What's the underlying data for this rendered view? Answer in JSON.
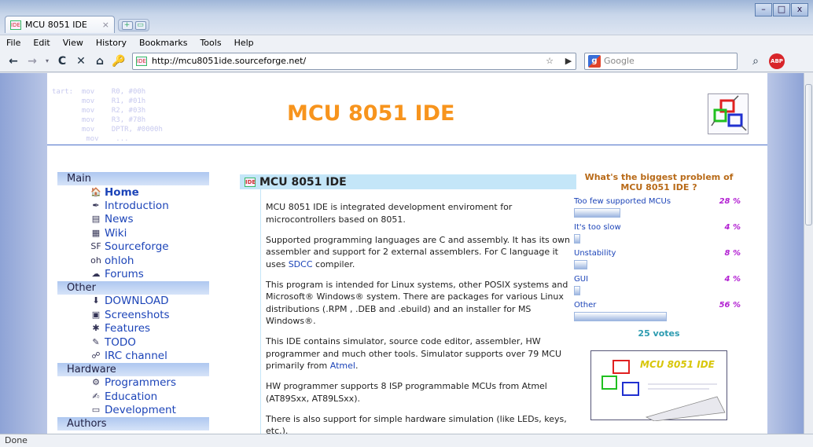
{
  "window": {
    "controls": [
      "–",
      "□",
      "x"
    ]
  },
  "tab": {
    "title": "MCU 8051 IDE",
    "close": "×"
  },
  "menu": [
    "File",
    "Edit",
    "View",
    "History",
    "Bookmarks",
    "Tools",
    "Help"
  ],
  "nav": {
    "back": "←",
    "forward": "→",
    "dropdown": "▾",
    "reload": "C",
    "stop": "✕",
    "home": "⌂",
    "url": "http://mcu8051ide.sourceforge.net/",
    "search_placeholder": "Google",
    "search_engine_letter": "g",
    "adblock_label": "ABP",
    "bookmark_star": "☆",
    "go_arrow": "▶",
    "search_button": "⌕"
  },
  "page": {
    "code_background": "tart:  mov    R0, #00h\n       mov    R1, #01h\n       mov    R2, #03h\n       mov    R3, #78h\n       mov    DPTR, #0000h\n        mov    ...",
    "site_title": "MCU 8051 IDE",
    "sidebar": {
      "sections": [
        {
          "title": "Main",
          "items": [
            {
              "label": "Home",
              "icon": "home-icon",
              "glyph": "🏠",
              "active": true
            },
            {
              "label": "Introduction",
              "icon": "pen-icon",
              "glyph": "✒",
              "active": false
            },
            {
              "label": "News",
              "icon": "news-icon",
              "glyph": "▤",
              "active": false
            },
            {
              "label": "Wiki",
              "icon": "wiki-icon",
              "glyph": "▦",
              "active": false
            },
            {
              "label": "Sourceforge",
              "icon": "sourceforge-icon",
              "glyph": "SF",
              "active": false
            },
            {
              "label": "ohloh",
              "icon": "ohloh-icon",
              "glyph": "oh",
              "active": false
            },
            {
              "label": "Forums",
              "icon": "forums-icon",
              "glyph": "☁",
              "active": false
            }
          ]
        },
        {
          "title": "Other",
          "items": [
            {
              "label": "DOWNLOAD",
              "icon": "download-icon",
              "glyph": "⬇",
              "active": false
            },
            {
              "label": "Screenshots",
              "icon": "screenshot-icon",
              "glyph": "▣",
              "active": false
            },
            {
              "label": "Features",
              "icon": "gear-icon",
              "glyph": "✱",
              "active": false
            },
            {
              "label": "TODO",
              "icon": "todo-icon",
              "glyph": "✎",
              "active": false
            },
            {
              "label": "IRC channel",
              "icon": "irc-icon",
              "glyph": "☍",
              "active": false
            }
          ]
        },
        {
          "title": "Hardware",
          "items": [
            {
              "label": "Programmers",
              "icon": "chip-icon",
              "glyph": "⚙",
              "active": false
            },
            {
              "label": "Education",
              "icon": "education-icon",
              "glyph": "✍",
              "active": false
            },
            {
              "label": "Development",
              "icon": "development-icon",
              "glyph": "▭",
              "active": false
            }
          ]
        },
        {
          "title": "Authors",
          "items": []
        }
      ]
    },
    "main": {
      "heading": "MCU 8051 IDE",
      "paragraphs": [
        {
          "text": "MCU 8051 IDE is integrated development enviroment for microcontrollers based on 8051."
        },
        {
          "text": "Supported programming languages are C and assembly. It has its own assembler and support for 2 external assemblers. For C language it uses ",
          "link": "SDCC",
          "after": " compiler."
        },
        {
          "text": "This program is intended for Linux systems, other POSIX systems and Microsoft® Windows® system. There are packages for various Linux distributions (.RPM , .DEB and .ebuild) and an installer for MS Windows®."
        },
        {
          "text": "This IDE contains simulator, source code editor, assembler, HW programmer and much other tools. Simulator supports over 79 MCU primarily from ",
          "link": "Atmel",
          "after": "."
        },
        {
          "text": "HW programmer supports 8 ISP programmable MCUs from Atmel (AT89Sxx, AT89LSxx)."
        },
        {
          "text": "There is also support for simple hardware simulation (like LEDs, keys, etc.)."
        }
      ]
    },
    "poll": {
      "question": "What's the biggest problem of MCU 8051 IDE ?",
      "options": [
        {
          "label": "Too few supported MCUs",
          "percent": "28 %",
          "value": 0.28
        },
        {
          "label": "It's too slow",
          "percent": "4 %",
          "value": 0.04
        },
        {
          "label": "Unstability",
          "percent": "8 %",
          "value": 0.08
        },
        {
          "label": "GUI",
          "percent": "4 %",
          "value": 0.04
        },
        {
          "label": "Other",
          "percent": "56 %",
          "value": 0.56
        }
      ],
      "votes": "25 votes",
      "promo_title": "MCU 8051 IDE"
    }
  },
  "status": "Done"
}
